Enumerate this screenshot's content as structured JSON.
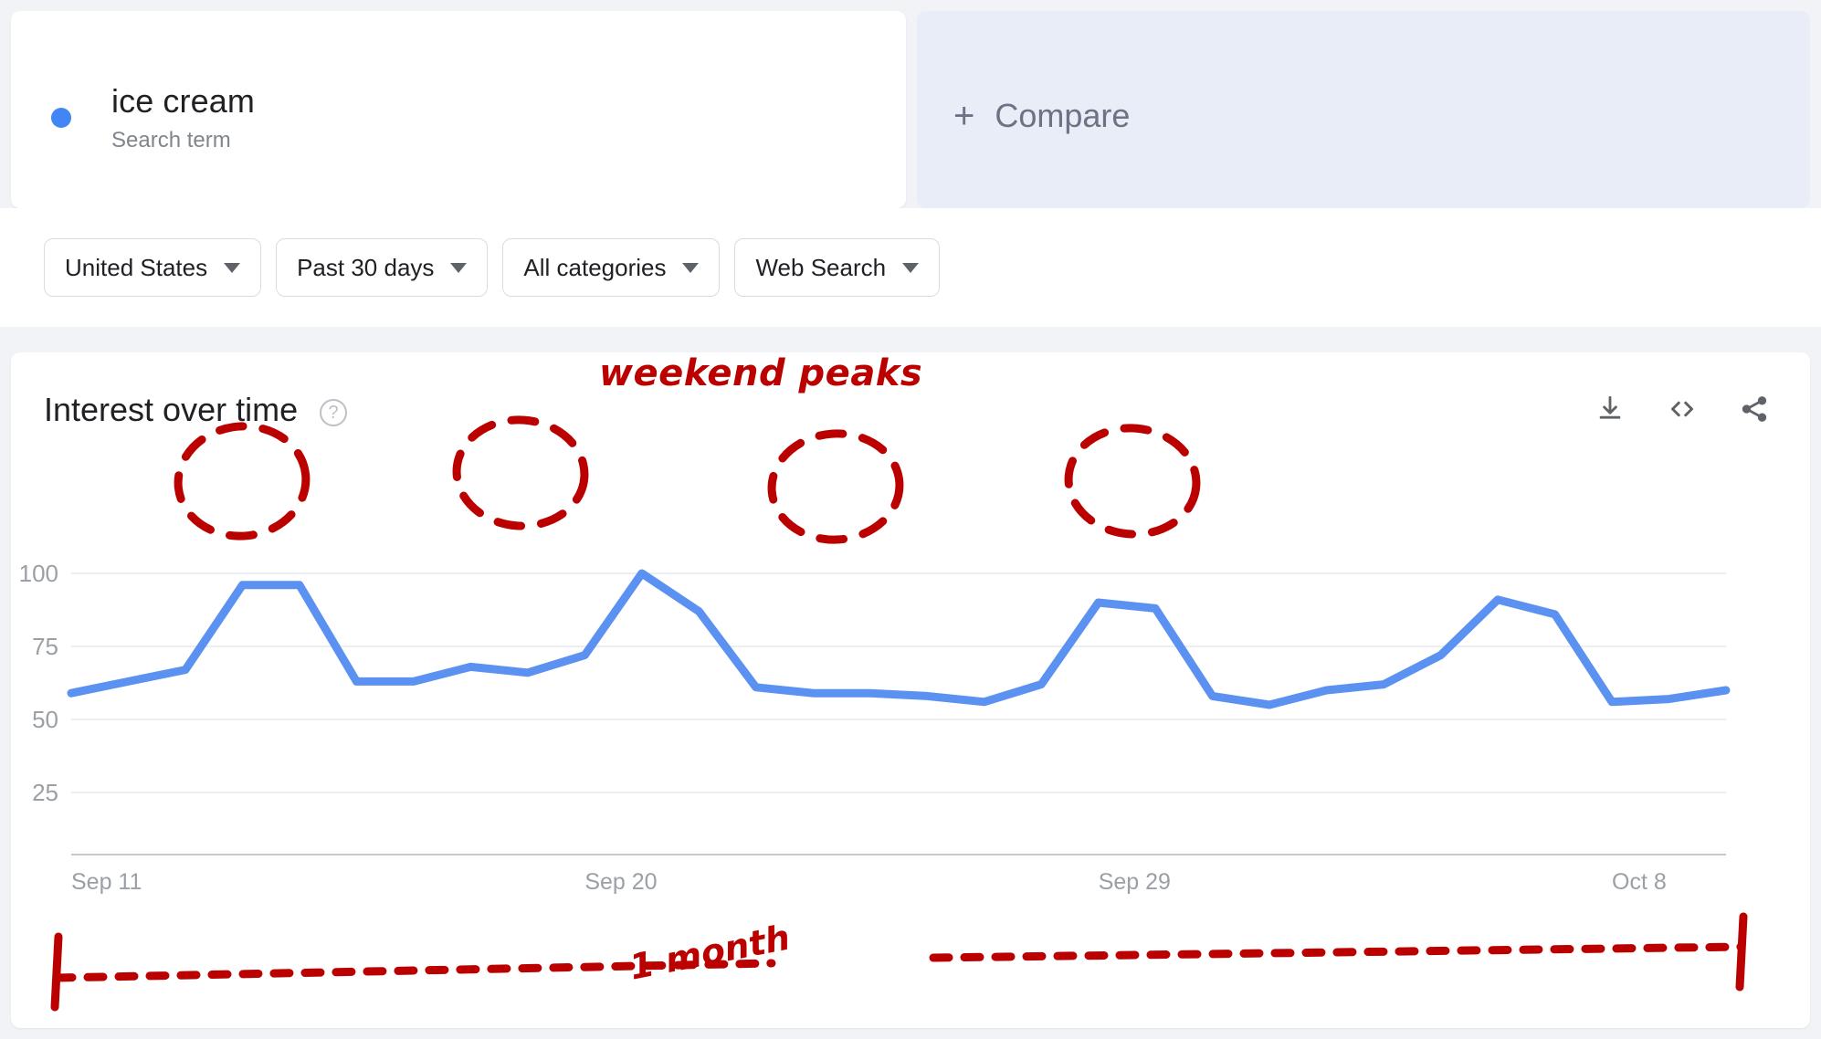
{
  "search_term": {
    "name": "ice cream",
    "type_label": "Search term",
    "dot_color": "#4285f4"
  },
  "compare": {
    "plus_icon": "plus-icon",
    "label": "Compare"
  },
  "filters": [
    {
      "label": "United States",
      "icon": "chevron-down-icon"
    },
    {
      "label": "Past 30 days",
      "icon": "chevron-down-icon"
    },
    {
      "label": "All categories",
      "icon": "chevron-down-icon"
    },
    {
      "label": "Web Search",
      "icon": "chevron-down-icon"
    }
  ],
  "card": {
    "title": "Interest over time",
    "help_icon": "help-circle-icon",
    "help_glyph": "?",
    "actions": [
      {
        "name": "download-icon"
      },
      {
        "name": "embed-code-icon"
      },
      {
        "name": "share-icon"
      }
    ]
  },
  "annotations": {
    "weekend_peaks": "weekend peaks",
    "one_month": "1 month",
    "color": "#bb0000",
    "circles": 4
  },
  "chart_data": {
    "type": "line",
    "title": "Interest over time",
    "xlabel": "",
    "ylabel": "",
    "ylim": [
      0,
      110
    ],
    "yticks": [
      25,
      50,
      75,
      100
    ],
    "grid": true,
    "legend": "none",
    "line_color": "#5b91f0",
    "xtick_labels": [
      "Sep 11",
      "Sep 20",
      "Sep 29",
      "Oct 8"
    ],
    "xtick_positions": [
      0,
      9,
      18,
      27
    ],
    "x": [
      "Sep 11",
      "Sep 12",
      "Sep 13",
      "Sep 14",
      "Sep 15",
      "Sep 16",
      "Sep 17",
      "Sep 18",
      "Sep 19",
      "Sep 20",
      "Sep 21",
      "Sep 22",
      "Sep 23",
      "Sep 24",
      "Sep 25",
      "Sep 26",
      "Sep 27",
      "Sep 28",
      "Sep 29",
      "Sep 30",
      "Oct 1",
      "Oct 2",
      "Oct 3",
      "Oct 4",
      "Oct 5",
      "Oct 6",
      "Oct 7",
      "Oct 8",
      "Oct 9",
      "Oct 10"
    ],
    "values": [
      59,
      63,
      67,
      96,
      96,
      63,
      63,
      68,
      66,
      72,
      100,
      87,
      61,
      59,
      59,
      58,
      56,
      62,
      90,
      88,
      58,
      55,
      60,
      62,
      72,
      91,
      86,
      56,
      57,
      60
    ],
    "series": [
      {
        "name": "ice cream",
        "values": [
          59,
          63,
          67,
          96,
          96,
          63,
          63,
          68,
          66,
          72,
          100,
          87,
          61,
          59,
          59,
          58,
          56,
          62,
          90,
          88,
          58,
          55,
          60,
          62,
          72,
          91,
          86,
          56,
          57,
          60
        ]
      }
    ],
    "annotations": [
      {
        "text": "weekend peaks",
        "color": "#bb0000"
      },
      {
        "text": "1 month",
        "color": "#bb0000"
      }
    ]
  }
}
